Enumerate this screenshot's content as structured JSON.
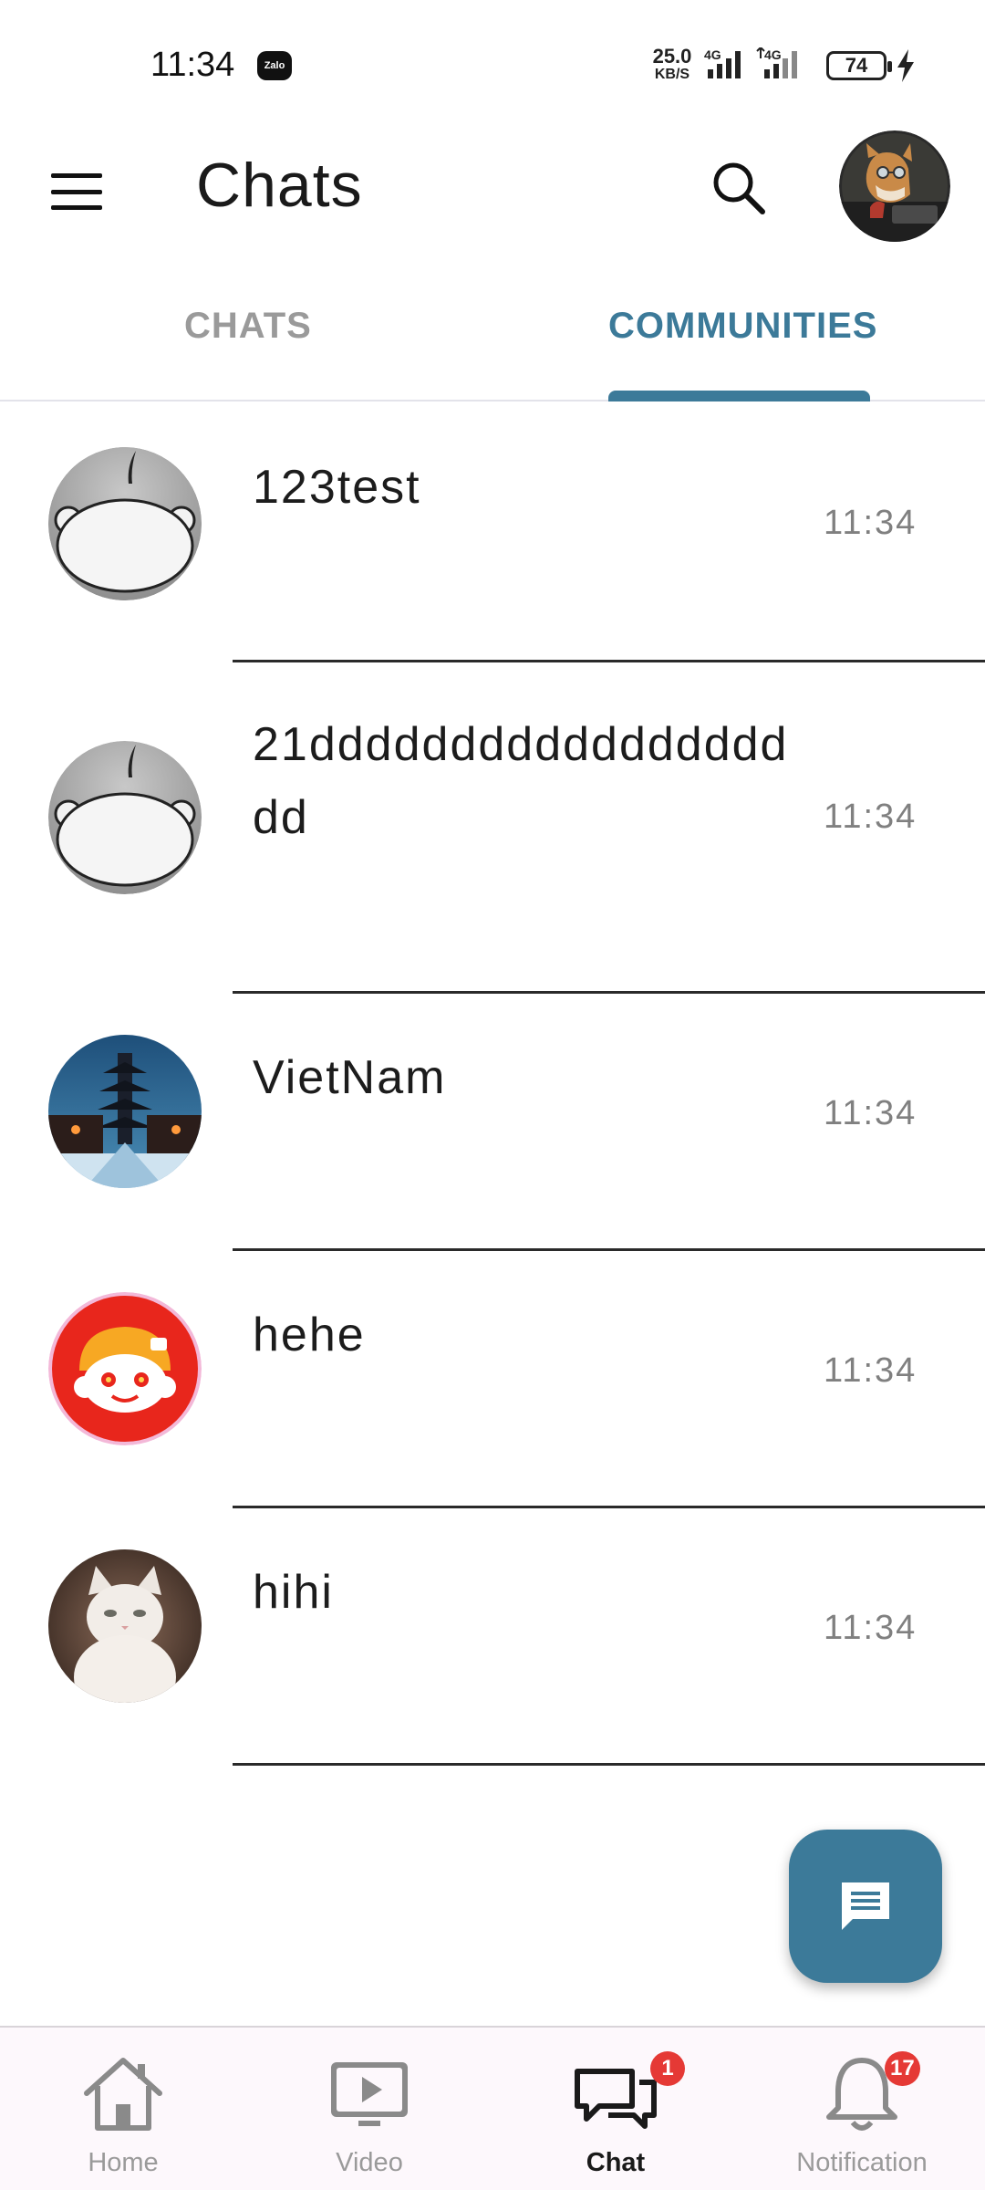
{
  "status_bar": {
    "time": "11:34",
    "zalo_label": "Zalo",
    "net_speed": "25.0",
    "net_unit": "KB/S",
    "signal_1": "4G",
    "signal_2": "4G",
    "battery": "74"
  },
  "app_bar": {
    "title": "Chats"
  },
  "tabs": [
    {
      "label": "CHATS",
      "active": false
    },
    {
      "label": "COMMUNITIES",
      "active": true
    }
  ],
  "chats": [
    {
      "name": "123test",
      "time": "11:34",
      "avatar": "default-reddit-avatar"
    },
    {
      "name": "21ddddddddddddddddddd",
      "time": "11:34",
      "avatar": "default-reddit-avatar"
    },
    {
      "name": "VietNam",
      "time": "11:34",
      "avatar": "pagoda-night-photo"
    },
    {
      "name": "hehe",
      "time": "11:34",
      "avatar": "orange-beanie-mascot"
    },
    {
      "name": "hihi",
      "time": "11:34",
      "avatar": "white-kitten-photo"
    }
  ],
  "bottom_nav": [
    {
      "label": "Home",
      "icon": "home-icon",
      "active": false
    },
    {
      "label": "Video",
      "icon": "video-icon",
      "active": false
    },
    {
      "label": "Chat",
      "icon": "chat-icon",
      "active": true,
      "badge": "1"
    },
    {
      "label": "Notification",
      "icon": "bell-icon",
      "active": false,
      "badge": "17"
    }
  ],
  "colors": {
    "accent": "#3c7a99",
    "badge": "#e53935",
    "inactive_text": "#9a9a9a"
  }
}
